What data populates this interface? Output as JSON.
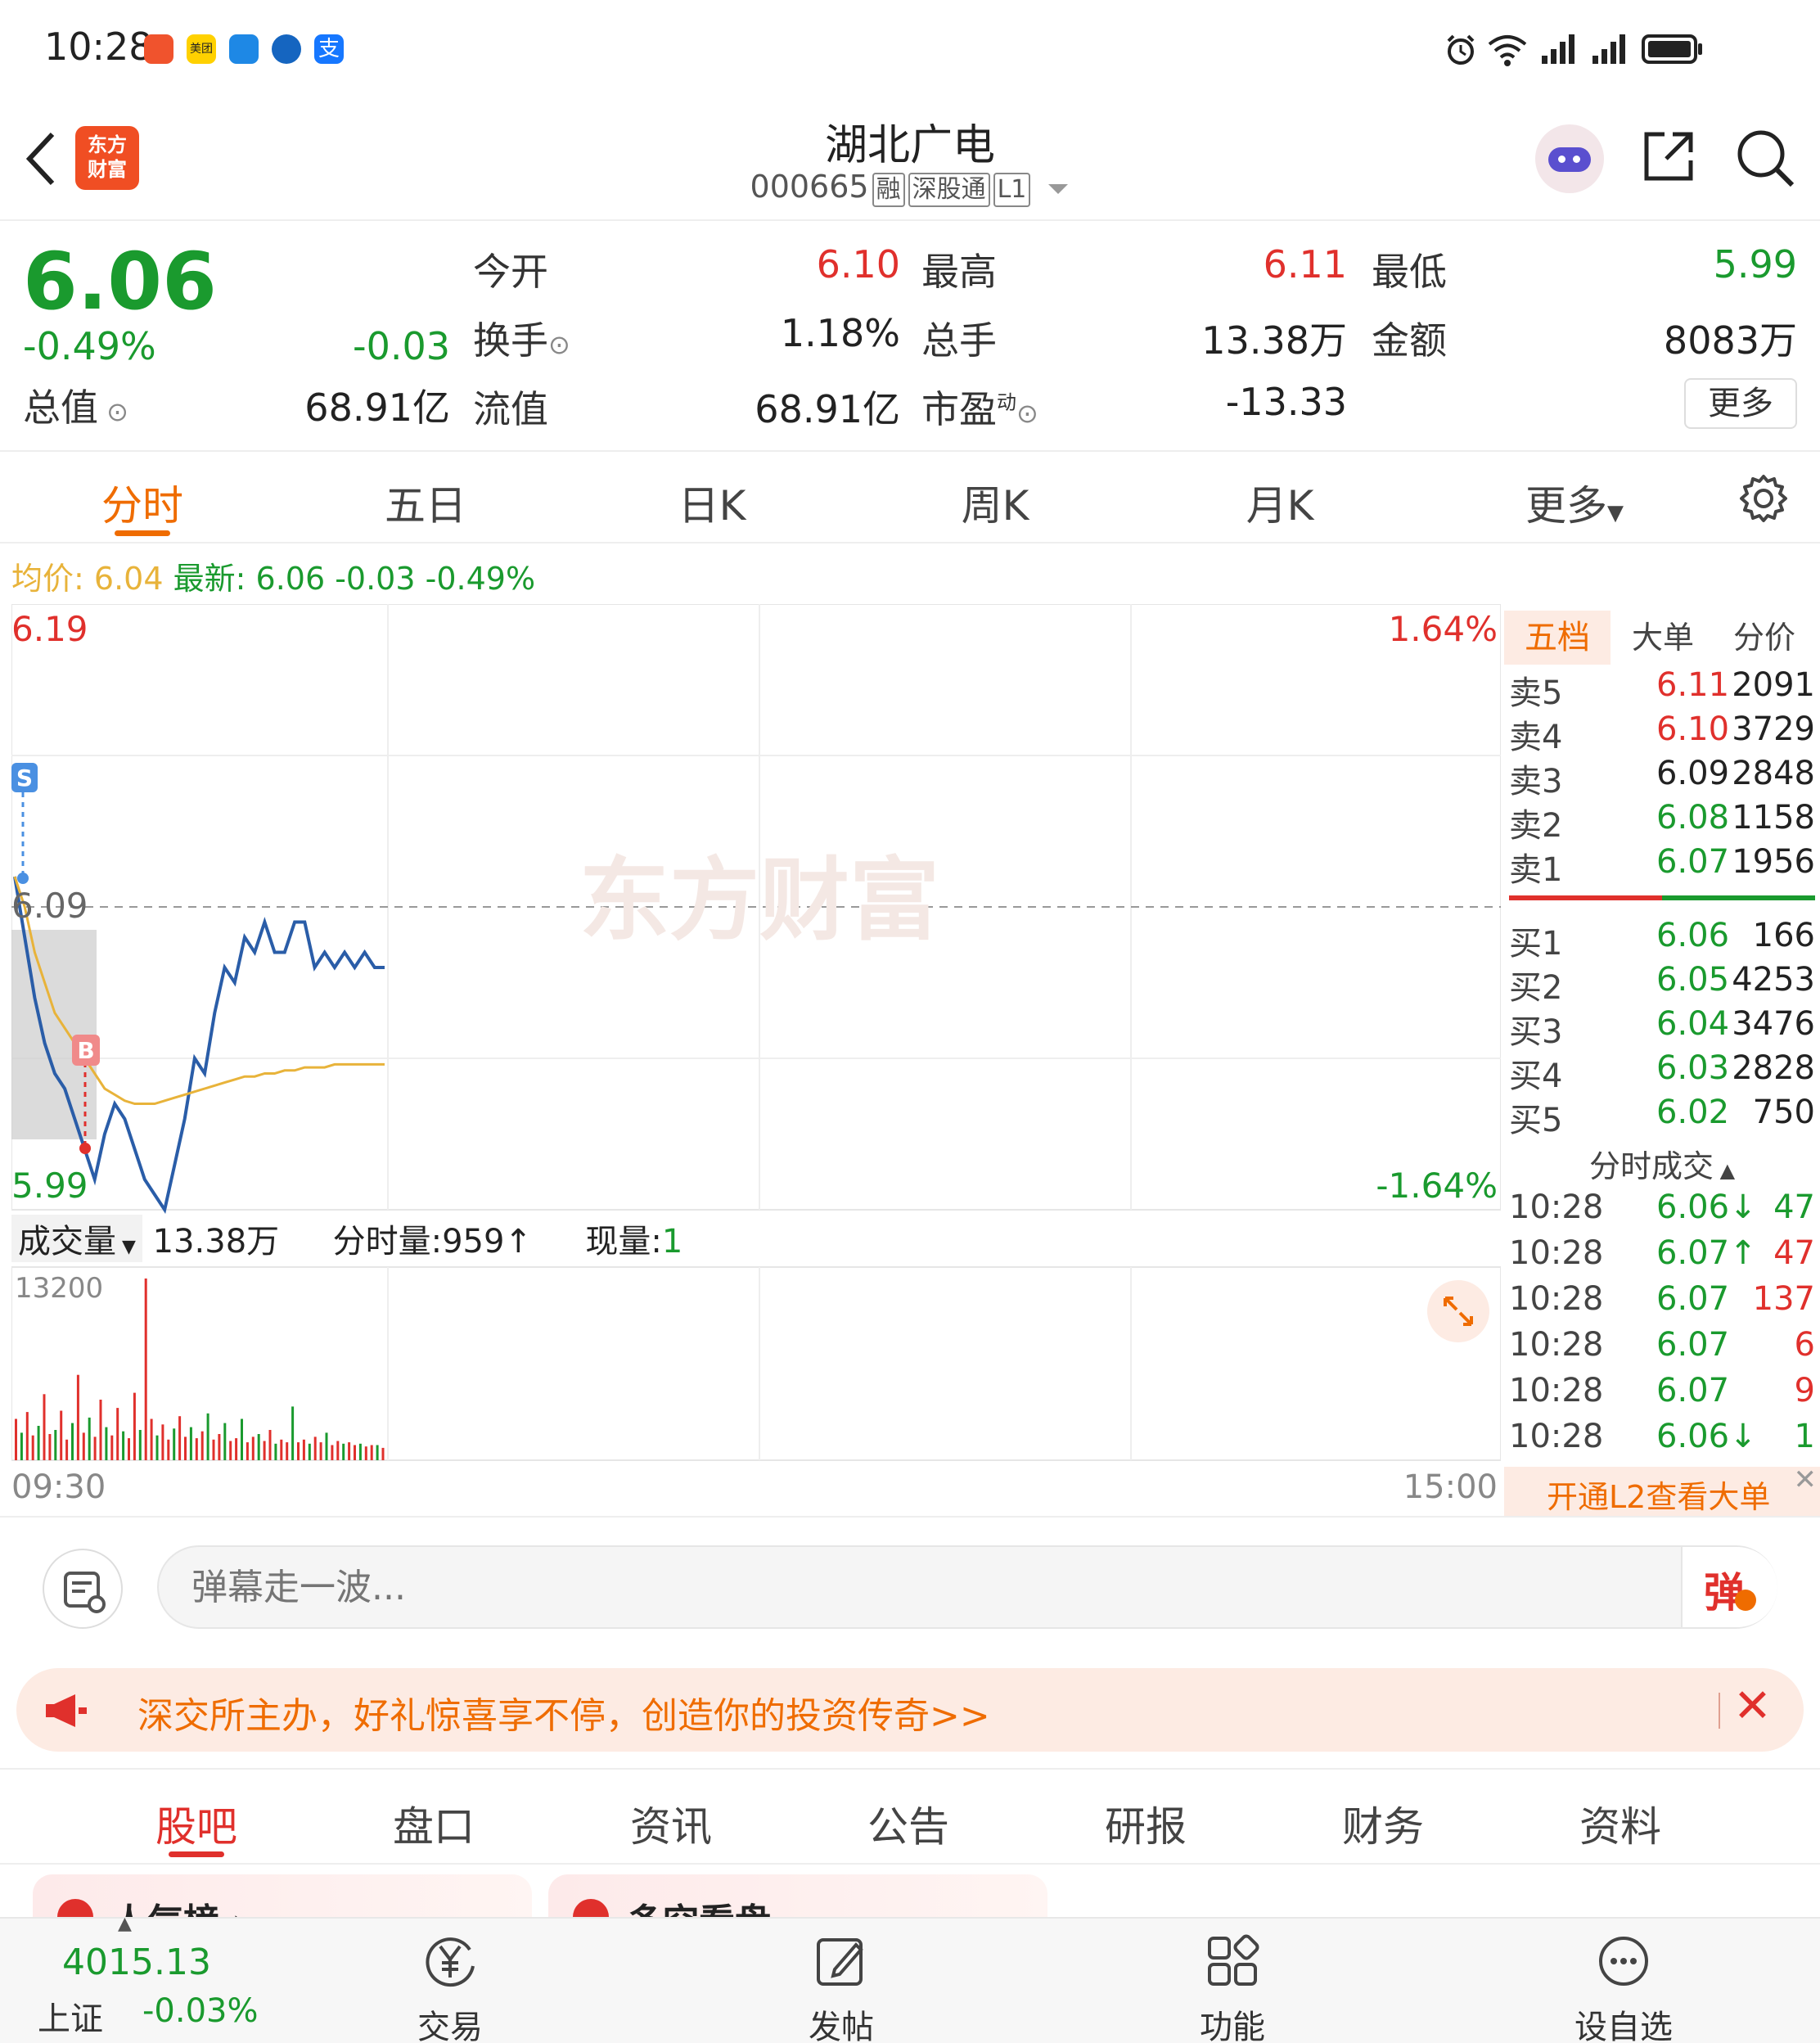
{
  "status_bar": {
    "time": "10:28",
    "app_icons": [
      "app-icon-red",
      "meituan-icon",
      "message-icon",
      "browser-icon",
      "alipay-icon"
    ],
    "meituan_text": "美团",
    "alipay_text": "支"
  },
  "header": {
    "logo_text": [
      "东方",
      "财富"
    ],
    "stock_name": "湖北广电",
    "stock_code": "000665",
    "tags": [
      "融",
      "深股通",
      "L1"
    ]
  },
  "quote": {
    "price": "6.06",
    "change_pct": "-0.49%",
    "change": "-0.03",
    "total_value_label": "总值",
    "total_value": "68.91亿",
    "rows": [
      {
        "l1": "今开",
        "v1": "6.10",
        "l2": "最高",
        "v2": "6.11",
        "l3": "最低",
        "v3": "5.99"
      },
      {
        "l1": "换手",
        "v1": "1.18%",
        "l2": "总手",
        "v2": "13.38万",
        "l3": "金额",
        "v3": "8083万"
      },
      {
        "l1": "流值",
        "v1": "68.91亿",
        "l2": "市盈",
        "v2": "-13.33"
      }
    ],
    "pe_superscript": "动",
    "more_label": "更多"
  },
  "chart_tabs": [
    "分时",
    "五日",
    "日K",
    "周K",
    "月K",
    "更多"
  ],
  "info_line": {
    "avg_label": "均价:",
    "avg_value": "6.04",
    "latest_label": "最新:",
    "latest_value": "6.06",
    "change": "-0.03",
    "change_pct": "-0.49%"
  },
  "chart": {
    "y_top": "6.19",
    "y_mid": "6.09",
    "y_bottom": "5.99",
    "pct_top": "1.64%",
    "pct_bottom": "-1.64%",
    "watermark": "东方财富",
    "marker_s": "S",
    "marker_b": "B",
    "volume_label": "成交量",
    "volume_total": "13.38万",
    "period_volume_label": "分时量:",
    "period_volume": "959",
    "current_volume_label": "现量:",
    "current_volume": "1",
    "volume_axis_max": "13200",
    "time_start": "09:30",
    "time_end": "15:00"
  },
  "chart_data": {
    "type": "line",
    "ylim": [
      5.99,
      6.19
    ],
    "series": [
      {
        "values": [
          6.1,
          6.08,
          6.06,
          6.045,
          6.035,
          6.03,
          6.02,
          6.01,
          6.0,
          6.015,
          6.025,
          6.02,
          6.01,
          6.0,
          5.995,
          5.99,
          6.005,
          6.02,
          6.04,
          6.035,
          6.055,
          6.07,
          6.065,
          6.08,
          6.075,
          6.085,
          6.075,
          6.075,
          6.085,
          6.085,
          6.07,
          6.075,
          6.07,
          6.075,
          6.07,
          6.075,
          6.07,
          6.07
        ]
      },
      {
        "values": [
          6.1,
          6.09,
          6.075,
          6.065,
          6.055,
          6.05,
          6.045,
          6.04,
          6.035,
          6.03,
          6.028,
          6.026,
          6.025,
          6.025,
          6.025,
          6.026,
          6.027,
          6.028,
          6.029,
          6.03,
          6.031,
          6.032,
          6.033,
          6.034,
          6.034,
          6.035,
          6.035,
          6.036,
          6.036,
          6.037,
          6.037,
          6.037,
          6.038,
          6.038,
          6.038,
          6.038,
          6.038,
          6.038
        ]
      }
    ],
    "volume": [
      3000,
      2000,
      3500,
      1800,
      2500,
      4800,
      1900,
      2200,
      3600,
      1500,
      2700,
      6200,
      2000,
      3100,
      1700,
      4400,
      2400,
      1800,
      3800,
      2100,
      1600,
      4900,
      2200,
      13200,
      3000,
      1800,
      2600,
      1500,
      2300,
      3200,
      1700,
      2400,
      1600,
      2100,
      3400,
      1500,
      1900,
      2700,
      1400,
      1600,
      3000,
      1300,
      1700,
      1900,
      1400,
      2200,
      1200,
      1500,
      1300,
      3900,
      1300,
      1500,
      1200,
      1700,
      1300,
      2000,
      1100,
      1400,
      1200,
      1300,
      1100,
      1200,
      1000,
      1100,
      1100,
      900
    ]
  },
  "order_book": {
    "tabs": [
      "五档",
      "大单",
      "分价"
    ],
    "asks": [
      {
        "label": "卖5",
        "price": "6.11",
        "vol": "2091",
        "color": "red"
      },
      {
        "label": "卖4",
        "price": "6.10",
        "vol": "3729",
        "color": "red"
      },
      {
        "label": "卖3",
        "price": "6.09",
        "vol": "2848",
        "color": "black"
      },
      {
        "label": "卖2",
        "price": "6.08",
        "vol": "1158",
        "color": "green"
      },
      {
        "label": "卖1",
        "price": "6.07",
        "vol": "1956",
        "color": "green"
      }
    ],
    "bids": [
      {
        "label": "买1",
        "price": "6.06",
        "vol": "166",
        "color": "green"
      },
      {
        "label": "买2",
        "price": "6.05",
        "vol": "4253",
        "color": "green"
      },
      {
        "label": "买3",
        "price": "6.04",
        "vol": "3476",
        "color": "green"
      },
      {
        "label": "买4",
        "price": "6.03",
        "vol": "2828",
        "color": "green"
      },
      {
        "label": "买5",
        "price": "6.02",
        "vol": "750",
        "color": "green"
      }
    ],
    "ticks_title": "分时成交",
    "ticks": [
      {
        "time": "10:28",
        "price": "6.06↓",
        "vol": "47",
        "vcolor": "green"
      },
      {
        "time": "10:28",
        "price": "6.07↑",
        "vol": "47",
        "vcolor": "red"
      },
      {
        "time": "10:28",
        "price": "6.07",
        "vol": "137",
        "vcolor": "red"
      },
      {
        "time": "10:28",
        "price": "6.07",
        "vol": "6",
        "vcolor": "red"
      },
      {
        "time": "10:28",
        "price": "6.07",
        "vol": "9",
        "vcolor": "red"
      },
      {
        "time": "10:28",
        "price": "6.06↓",
        "vol": "1",
        "vcolor": "green"
      }
    ],
    "l2_banner": "开通L2查看大单"
  },
  "danmu": {
    "placeholder": "弹幕走一波...",
    "send_label": "弹"
  },
  "promo": {
    "text": "深交所主办，好礼惊喜享不停，创造你的投资传奇>>"
  },
  "section_tabs": [
    "股吧",
    "盘口",
    "资讯",
    "公告",
    "研报",
    "财务",
    "资料"
  ],
  "partial_cards": [
    "人气榜 ›",
    "多空看盘"
  ],
  "bottom_nav": {
    "index_value": "4015.13",
    "index_name": "上证",
    "index_change": "-0.03%",
    "items": [
      "交易",
      "发帖",
      "功能",
      "设自选"
    ]
  },
  "colors": {
    "accent": "#ef6c00",
    "up": "#e0302c",
    "down": "#1a9a2e",
    "price_line": "#2a5da8",
    "avg_line": "#e8b33a"
  }
}
